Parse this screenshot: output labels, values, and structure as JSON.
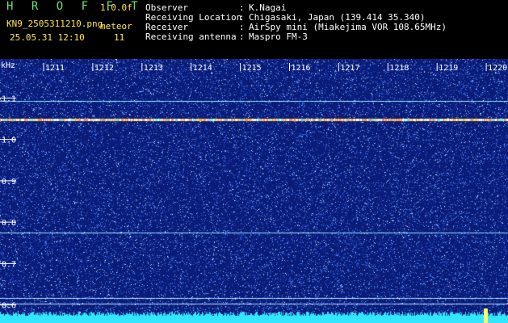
{
  "header": {
    "app_title": "H R O F F T",
    "version": "1.0.0f",
    "filename": "KN9_2505311210.png",
    "datetime": "25.05.31 12:10",
    "meteor_label": "meteor",
    "meteor_count": "11",
    "fields": [
      {
        "label": "Observer",
        "value": "K.Nagai"
      },
      {
        "label": "Receiving Location",
        "value": "Chigasaki, Japan (139.414 35.340)"
      },
      {
        "label": "Receiver",
        "value": "AirSpy mini (Miakejima VOR 108.65MHz)"
      },
      {
        "label": "Receiving antenna",
        "value": "Maspro FM-3"
      }
    ]
  },
  "spectrogram": {
    "unit_label": "kHz",
    "time_labels": [
      "1211",
      "1212",
      "1213",
      "1214",
      "1215",
      "1216",
      "1217",
      "1218",
      "1219",
      "1220"
    ],
    "freq_labels": [
      "1.1",
      "1.0",
      "0.9",
      "0.8",
      "0.7",
      "0.6"
    ],
    "freq_values": [
      1.1,
      1.0,
      0.9,
      0.8,
      0.7,
      0.6
    ],
    "freq_range": [
      0.57,
      1.165
    ],
    "signal_lines_khz": [
      {
        "freq": 1.093,
        "color": "#9fe8ff",
        "kind": "faint"
      },
      {
        "freq": 1.048,
        "color": "#ffcc55",
        "kind": "strong"
      },
      {
        "freq": 0.775,
        "color": "#9fe8ff",
        "kind": "faint"
      },
      {
        "freq": 0.617,
        "color": "#c8e8ff",
        "kind": "thin"
      },
      {
        "freq": 0.603,
        "color": "#c8e8ff",
        "kind": "thin"
      }
    ],
    "colors": {
      "background": "#0a1c78",
      "noise": "#6aa8ff",
      "base": "#33e6ff"
    }
  }
}
